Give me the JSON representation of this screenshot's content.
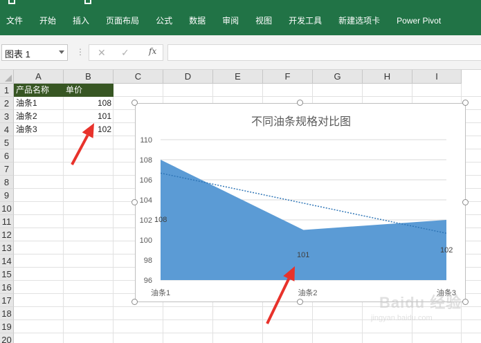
{
  "ribbon": {
    "tabs": [
      "文件",
      "开始",
      "插入",
      "页面布局",
      "公式",
      "数据",
      "审阅",
      "视图",
      "开发工具",
      "新建选项卡",
      "Power Pivot"
    ]
  },
  "formula_bar": {
    "name_box": "图表 1",
    "formula": "",
    "cancel_icon": "x-icon",
    "enter_icon": "check-icon",
    "fx_label": "fx"
  },
  "sheet": {
    "columns": [
      "A",
      "B",
      "C",
      "D",
      "E",
      "F",
      "G",
      "H",
      "I"
    ],
    "rows": [
      "1",
      "2",
      "3",
      "4",
      "5",
      "6",
      "7",
      "8",
      "9",
      "10",
      "11",
      "12",
      "13",
      "14",
      "15",
      "16",
      "17",
      "18",
      "19",
      "20"
    ],
    "header_row": {
      "a": "产品名称",
      "b": "单价"
    },
    "data": [
      {
        "name": "油条1",
        "price": "108"
      },
      {
        "name": "油条2",
        "price": "101"
      },
      {
        "name": "油条3",
        "price": "102"
      }
    ]
  },
  "chart_data": {
    "type": "area",
    "title": "不同油条规格对比图",
    "categories": [
      "油条1",
      "油条2",
      "油条3"
    ],
    "series": [
      {
        "values": [
          108,
          101,
          102
        ]
      }
    ],
    "data_labels": [
      "108",
      "101",
      "102"
    ],
    "y_ticks": [
      "96",
      "98",
      "100",
      "102",
      "104",
      "106",
      "108",
      "110"
    ],
    "ylim": [
      96,
      110
    ],
    "gridlines": true,
    "trendline": "linear dotted",
    "colors": {
      "area": "#5B9BD5",
      "trendline": "#2E75B6",
      "gridline": "#d9d9d9"
    }
  },
  "annotations": {
    "arrow_color": "#e8322b"
  },
  "watermark": {
    "text": "Baidu 经验",
    "url": "jingyan.baidu.com"
  }
}
